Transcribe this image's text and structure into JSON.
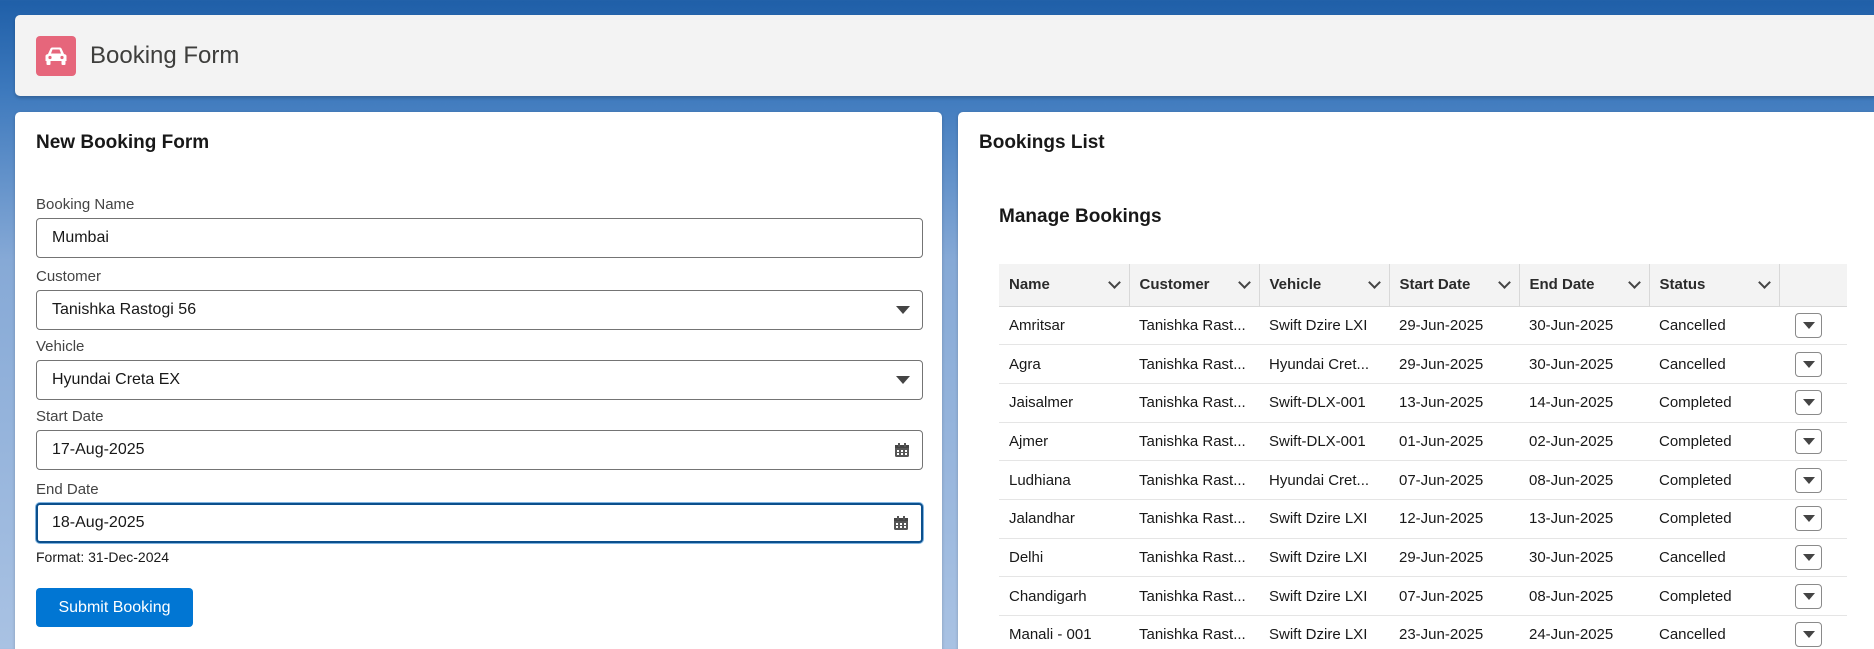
{
  "header": {
    "title": "Booking Form",
    "icon": "car-icon",
    "icon_color": "#e6667b"
  },
  "form": {
    "title": "New Booking Form",
    "booking_name": {
      "label": "Booking Name",
      "value": "Mumbai"
    },
    "customer": {
      "label": "Customer",
      "value": "Tanishka Rastogi 56"
    },
    "vehicle": {
      "label": "Vehicle",
      "value": "Hyundai Creta EX"
    },
    "start_date": {
      "label": "Start Date",
      "value": "17-Aug-2025"
    },
    "end_date": {
      "label": "End Date",
      "value": "18-Aug-2025"
    },
    "format_hint": "Format: 31-Dec-2024",
    "submit_label": "Submit Booking"
  },
  "list": {
    "title": "Bookings List",
    "subtitle": "Manage Bookings",
    "columns": [
      "Name",
      "Customer",
      "Vehicle",
      "Start Date",
      "End Date",
      "Status"
    ],
    "rows": [
      [
        "Amritsar",
        "Tanishka Rast...",
        "Swift Dzire LXI",
        "29-Jun-2025",
        "30-Jun-2025",
        "Cancelled"
      ],
      [
        "Agra",
        "Tanishka Rast...",
        "Hyundai Cret...",
        "29-Jun-2025",
        "30-Jun-2025",
        "Cancelled"
      ],
      [
        "Jaisalmer",
        "Tanishka Rast...",
        "Swift-DLX-001",
        "13-Jun-2025",
        "14-Jun-2025",
        "Completed"
      ],
      [
        "Ajmer",
        "Tanishka Rast...",
        "Swift-DLX-001",
        "01-Jun-2025",
        "02-Jun-2025",
        "Completed"
      ],
      [
        "Ludhiana",
        "Tanishka Rast...",
        "Hyundai Cret...",
        "07-Jun-2025",
        "08-Jun-2025",
        "Completed"
      ],
      [
        "Jalandhar",
        "Tanishka Rast...",
        "Swift Dzire LXI",
        "12-Jun-2025",
        "13-Jun-2025",
        "Completed"
      ],
      [
        "Delhi",
        "Tanishka Rast...",
        "Swift Dzire LXI",
        "29-Jun-2025",
        "30-Jun-2025",
        "Cancelled"
      ],
      [
        "Chandigarh",
        "Tanishka Rast...",
        "Swift Dzire LXI",
        "07-Jun-2025",
        "08-Jun-2025",
        "Completed"
      ],
      [
        "Manali - 001",
        "Tanishka Rast...",
        "Swift Dzire LXI",
        "23-Jun-2025",
        "24-Jun-2025",
        "Cancelled"
      ]
    ]
  },
  "colors": {
    "primary_button": "#0176d3",
    "focus_border": "#0b4f8c"
  }
}
